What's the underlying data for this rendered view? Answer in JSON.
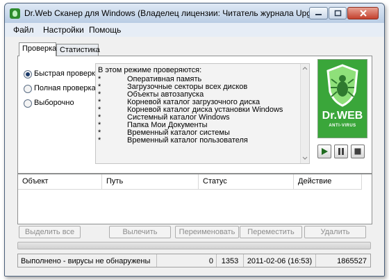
{
  "window": {
    "title": "Dr.Web Сканер для Windows (Владелец лицензии: Читатель журнала Upgrade Spec..."
  },
  "menu": [
    "Файл",
    "Настройки",
    "Помощь"
  ],
  "tabs": [
    "Проверка",
    "Статистика"
  ],
  "scan_modes": [
    {
      "label": "Быстрая проверка",
      "selected": true
    },
    {
      "label": "Полная проверка",
      "selected": false
    },
    {
      "label": "Выборочно",
      "selected": false
    }
  ],
  "info": {
    "header": "В этом режиме проверяются:",
    "bullet": "*",
    "items": [
      "Оперативная память",
      "Загрузочные секторы всех дисков",
      "Объекты автозапуска",
      "Корневой каталог загрузочного диска",
      "Корневой каталог диска установки Windows",
      "Системный каталог Windows",
      "Папка Мои Документы",
      "Временный каталог системы",
      "Временный каталог пользователя"
    ]
  },
  "logo": {
    "brand": "Dr.WEB",
    "sub": "ANTI-VIRUS"
  },
  "controls": [
    "play-icon",
    "pause-icon",
    "stop-icon"
  ],
  "table": {
    "columns": [
      "Объект",
      "Путь",
      "Статус",
      "Действие"
    ]
  },
  "actions": {
    "select_all": "Выделить все",
    "cure": "Вылечить",
    "rename": "Переименовать",
    "move": "Переместить",
    "delete": "Удалить"
  },
  "progress": 0,
  "status": {
    "message": "Выполнено - вирусы не обнаружены",
    "infected": "0",
    "checked": "1353",
    "datetime": "2011-02-06 (16:53)",
    "records": "1865527"
  },
  "colors": {
    "logo_green": "#3aa63a",
    "title_gradient": "#b9cde4"
  }
}
